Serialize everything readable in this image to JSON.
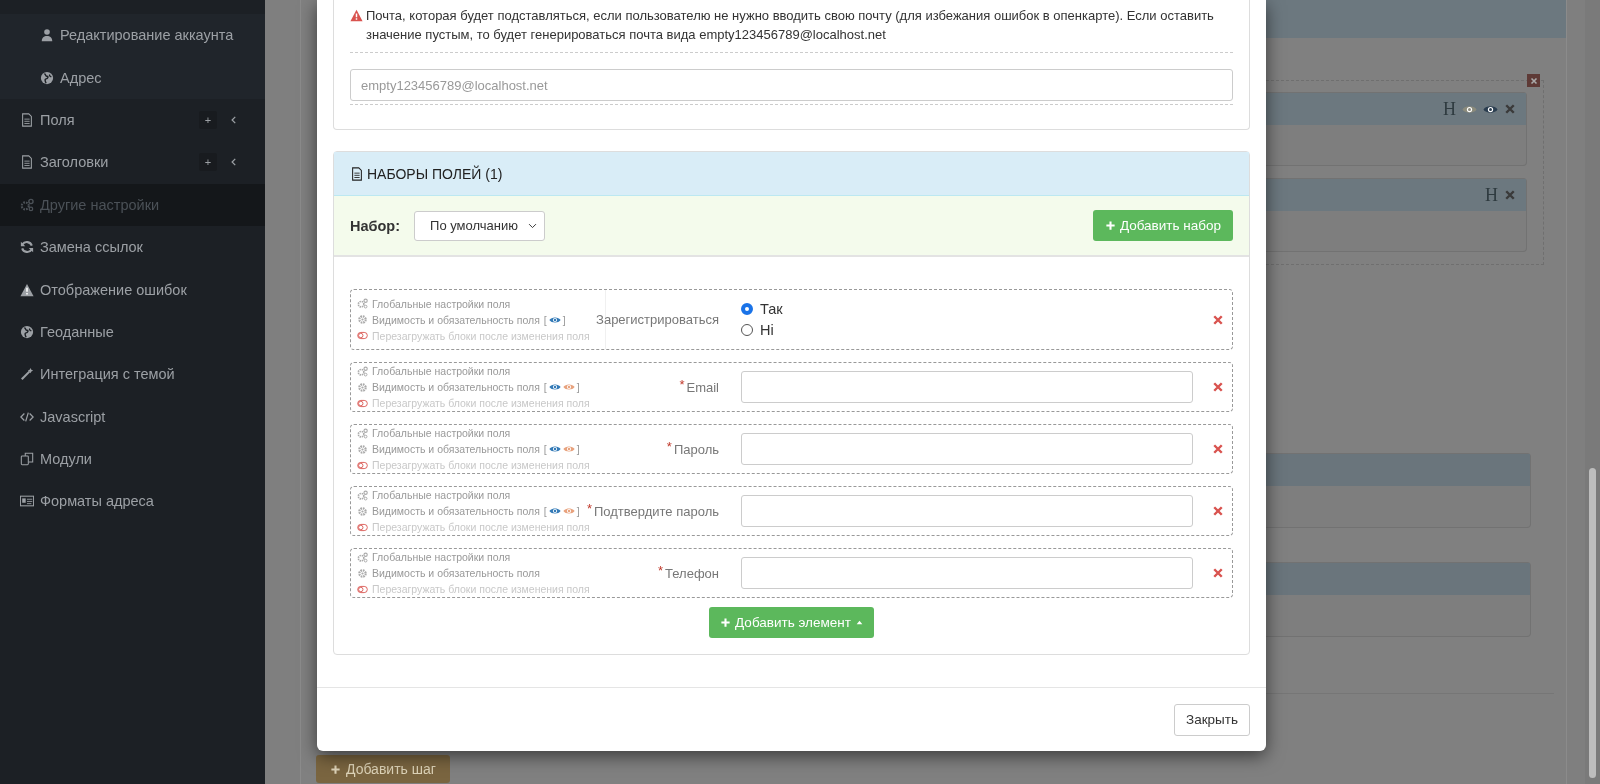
{
  "sidebar": {
    "items": [
      {
        "label": "Редактирование аккаунта",
        "kind": "sub",
        "selected": false
      },
      {
        "label": "Адрес",
        "kind": "sub",
        "selected": false
      },
      {
        "label": "Поля",
        "kind": "item",
        "selected": false,
        "add": "+",
        "expandable": true
      },
      {
        "label": "Заголовки",
        "kind": "item",
        "selected": false,
        "add": "+",
        "expandable": true
      },
      {
        "label": "Другие настройки",
        "kind": "item",
        "selected": true
      },
      {
        "label": "Замена ссылок",
        "kind": "item",
        "selected": false
      },
      {
        "label": "Отображение ошибок",
        "kind": "item",
        "selected": false
      },
      {
        "label": "Геоданные",
        "kind": "item",
        "selected": false
      },
      {
        "label": "Интеграция с темой",
        "kind": "item",
        "selected": false
      },
      {
        "label": "Javascript",
        "kind": "item",
        "selected": false
      },
      {
        "label": "Модули",
        "kind": "item",
        "selected": false
      },
      {
        "label": "Форматы адреса",
        "kind": "item",
        "selected": false
      }
    ]
  },
  "background": {
    "cards": [
      {
        "kind": "tools",
        "tools": [
          {
            "kind": "heading",
            "text": "H"
          },
          {
            "kind": "eye-muted"
          },
          {
            "kind": "eye"
          },
          {
            "kind": "delete"
          }
        ]
      },
      {
        "kind": "tools",
        "tools": [
          {
            "kind": "heading",
            "text": "H"
          },
          {
            "kind": "delete"
          }
        ]
      },
      {
        "kind": "plain"
      },
      {
        "kind": "plain"
      }
    ],
    "add_step_button": "Добавить шаг"
  },
  "modal": {
    "notice": "Почта, которая будет подставляться, если пользователю не нужно вводить свою почту (для избежания ошибок в опенкарте). Если оставить значение пустым, то будет генерироваться почта вида empty123456789@localhost.net",
    "email_field": {
      "placeholder": "empty123456789@localhost.net"
    },
    "field_sets": {
      "title": "НАБОРЫ ПОЛЕЙ (1)",
      "set_label": "Набор:",
      "set_select": "По умолчанию",
      "add_set_button": "Добавить набор",
      "fields": [
        {
          "meta": [
            "Глобальные настройки поля",
            "Видимость и обязательность поля",
            "Перезагружать блоки после изменения поля"
          ],
          "visibility": {
            "open": "[",
            "icons": [
              {
                "kind": "visible"
              }
            ],
            "close": "]"
          },
          "label": "Зарегистрироваться",
          "kind": "radio",
          "options": [
            {
              "label": "Так",
              "selected": true
            },
            {
              "label": "Ні",
              "selected": false
            }
          ]
        },
        {
          "meta": [
            "Глобальные настройки поля",
            "Видимость и обязательность поля",
            "Перезагружать блоки после изменения поля"
          ],
          "visibility": {
            "open": "[",
            "icons": [
              {
                "kind": "visible"
              },
              {
                "kind": "required"
              }
            ],
            "close": "]"
          },
          "required_mark": "*",
          "label": "Email",
          "kind": "text"
        },
        {
          "meta": [
            "Глобальные настройки поля",
            "Видимость и обязательность поля",
            "Перезагружать блоки после изменения поля"
          ],
          "visibility": {
            "open": "[",
            "icons": [
              {
                "kind": "visible"
              },
              {
                "kind": "required"
              }
            ],
            "close": "]"
          },
          "required_mark": "*",
          "label": "Пароль",
          "kind": "text"
        },
        {
          "meta": [
            "Глобальные настройки поля",
            "Видимость и обязательность поля",
            "Перезагружать блоки после изменения поля"
          ],
          "visibility": {
            "open": "[",
            "icons": [
              {
                "kind": "visible"
              },
              {
                "kind": "required"
              }
            ],
            "close": "]"
          },
          "required_mark": "*",
          "label": "Подтвердите пароль",
          "kind": "text"
        },
        {
          "meta": [
            "Глобальные настройки поля",
            "Видимость и обязательность поля",
            "Перезагружать блоки после изменения поля"
          ],
          "required_mark": "*",
          "label": "Телефон",
          "kind": "text"
        }
      ],
      "add_element_button": "Добавить элемент"
    },
    "close_button": "Закрыть"
  }
}
